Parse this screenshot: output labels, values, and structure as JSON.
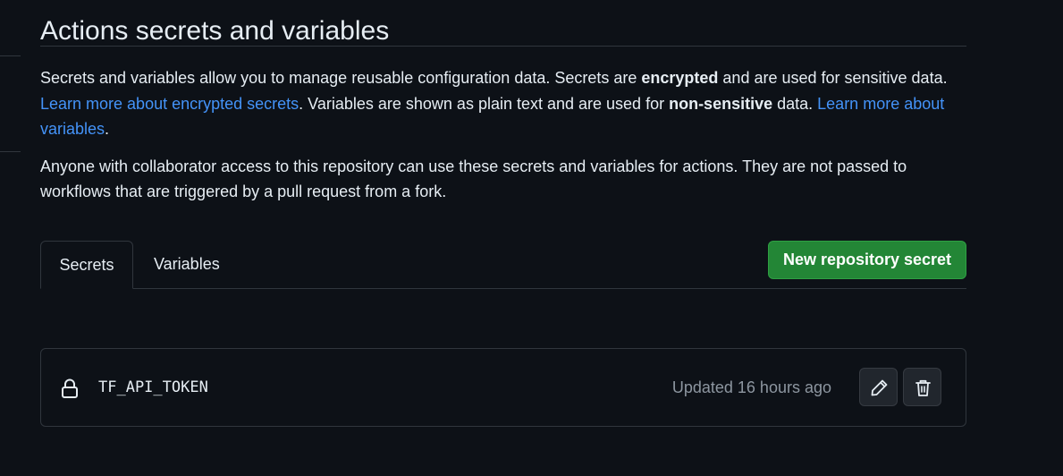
{
  "page": {
    "title": "Actions secrets and variables"
  },
  "intro": {
    "p1_part1": "Secrets and variables allow you to manage reusable configuration data. Secrets are ",
    "p1_bold1": "encrypted",
    "p1_part2": " and are used for sensitive data. ",
    "p1_link1": "Learn more about encrypted secrets",
    "p1_part3": ". Variables are shown as plain text and are used for ",
    "p1_bold2": "non-sensitive",
    "p1_part4": " data. ",
    "p1_link2": "Learn more about variables",
    "p1_part5": ".",
    "p2": "Anyone with collaborator access to this repository can use these secrets and variables for actions. They are not passed to workflows that are triggered by a pull request from a fork."
  },
  "tabs": [
    {
      "label": "Secrets",
      "active": true
    },
    {
      "label": "Variables",
      "active": false
    }
  ],
  "actions": {
    "new_secret_label": "New repository secret"
  },
  "secrets": [
    {
      "icon": "lock-icon",
      "name": "TF_API_TOKEN",
      "updated": "Updated 16 hours ago"
    }
  ],
  "colors": {
    "background": "#0d1117",
    "border": "#30363d",
    "link": "#4493f8",
    "primary_button": "#238636",
    "muted_text": "#8d96a0"
  }
}
